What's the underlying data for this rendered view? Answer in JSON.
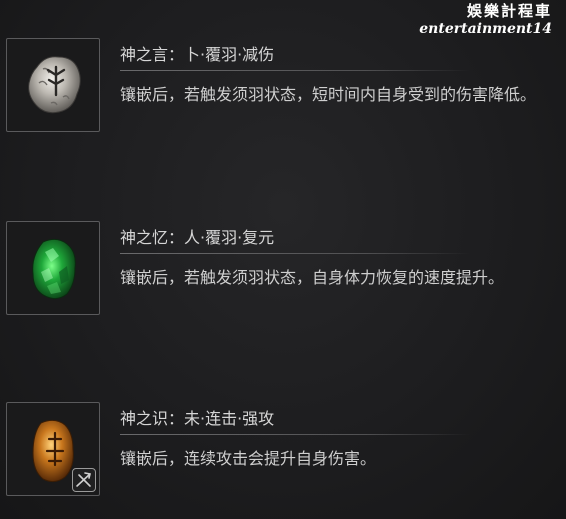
{
  "watermark": {
    "line1": "娛樂計程車",
    "line2": "entertainment14"
  },
  "items": [
    {
      "title": "神之言：卜·覆羽·减伤",
      "desc": "镶嵌后，若触发须羽状态，短时间内自身受到的伤害降低。",
      "icon": "silver-rune-stone-icon"
    },
    {
      "title": "神之忆：人·覆羽·复元",
      "desc": "镶嵌后，若触发须羽状态，自身体力恢复的速度提升。",
      "icon": "green-jade-stone-icon"
    },
    {
      "title": "神之识：未·连击·强攻",
      "desc": "镶嵌后，连续攻击会提升自身伤害。",
      "icon": "amber-rune-stone-icon"
    }
  ],
  "colors": {
    "background": "#1c1c1e",
    "text": "#d6d6d6",
    "frame": "#5a5a5c",
    "silver": "#c9c6c0",
    "green": "#1fa83a",
    "amber": "#c9771d"
  }
}
